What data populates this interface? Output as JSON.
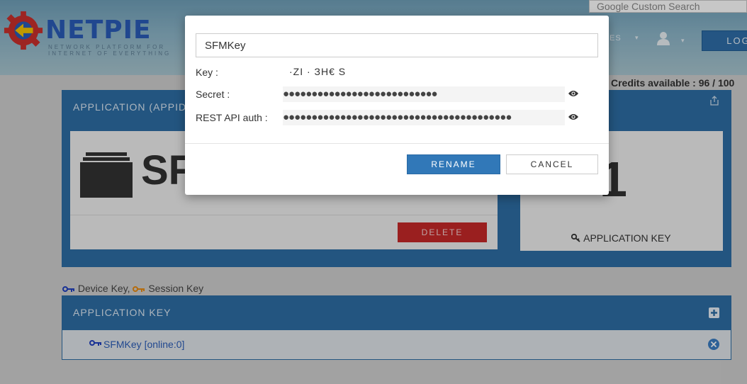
{
  "header": {
    "logo_text": "NETPIE",
    "logo_tagline": "NETWORK PLATFORM FOR INTERNET OF EVERYTHING",
    "search_placeholder": "Google Custom Search",
    "nav_partial": "ES",
    "login_partial": "LOG",
    "credits": "Credits available : 96 / 100"
  },
  "app_panel": {
    "title": "APPLICATION (APPID",
    "app_name_partial": "SF",
    "delete_label": "DELETE",
    "key_count": "1",
    "app_key_label": "APPLICATION KEY"
  },
  "legend": {
    "device_key": "Device Key,",
    "session_key": "Session Key"
  },
  "key_panel": {
    "title": "APPLICATION KEY",
    "items": [
      {
        "label": "SFMKey [online:0]"
      }
    ]
  },
  "modal": {
    "name_value": "SFMKey",
    "key_label": "Key :",
    "key_value": "·ZI     ·    ЗН€  S",
    "secret_label": "Secret :",
    "secret_mask": "●●●●●●●●●●●●●●●●●●●●●●●●●●●",
    "rest_label": "REST API auth :",
    "rest_mask": "●●●●●●●●●●●●●●●●●●●●●●●●●●●●●●●●●●●●●●●●",
    "rename_label": "RENAME",
    "cancel_label": "CANCEL"
  },
  "colors": {
    "panel_blue": "#2e6da4",
    "primary_button": "#3178b8",
    "danger_button": "#c62828",
    "key_blue": "#1f3fbf",
    "key_orange": "#e88a10"
  },
  "icons": [
    "netpie-gear-icon",
    "user-icon",
    "share-icon",
    "folder-icon",
    "key-icon",
    "plus-icon",
    "remove-icon",
    "eye-icon"
  ]
}
